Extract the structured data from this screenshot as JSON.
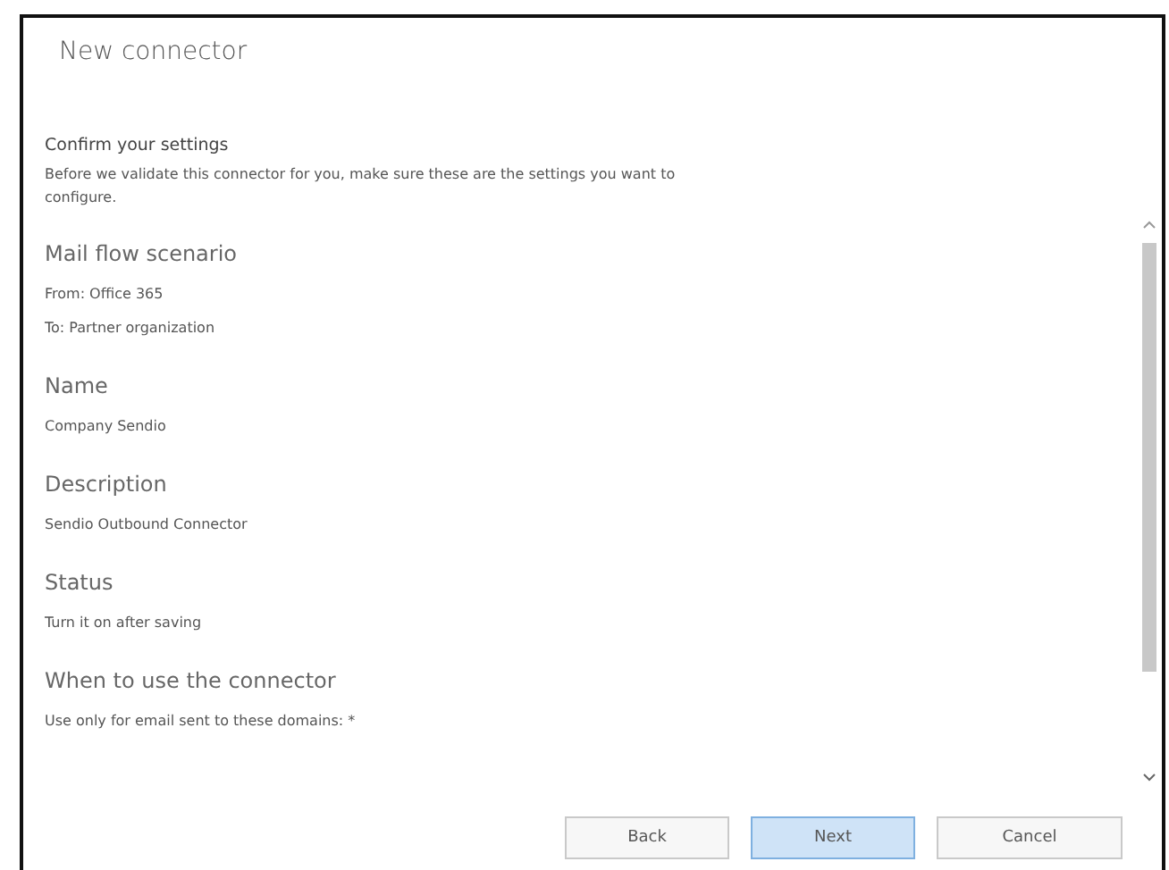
{
  "window": {
    "title": "New connector"
  },
  "sections": [
    {
      "kind": "intro",
      "heading": "Confirm your settings",
      "lines": [
        "Before we validate this connector for you, make sure these are the settings you want to configure."
      ]
    },
    {
      "kind": "setting",
      "heading": "Mail flow scenario",
      "lines": [
        "From: Office 365",
        "To: Partner organization"
      ]
    },
    {
      "kind": "setting",
      "heading": "Name",
      "lines": [
        "Company Sendio"
      ]
    },
    {
      "kind": "setting",
      "heading": "Description",
      "lines": [
        "Sendio Outbound Connector"
      ]
    },
    {
      "kind": "setting",
      "heading": "Status",
      "lines": [
        "Turn it on after saving"
      ]
    },
    {
      "kind": "setting",
      "heading": "When to use the connector",
      "lines": [
        "Use only for email sent to these domains: *"
      ]
    }
  ],
  "buttons": [
    {
      "label": "Back",
      "default": false
    },
    {
      "label": "Next",
      "default": true
    },
    {
      "label": "Cancel",
      "default": false
    }
  ]
}
